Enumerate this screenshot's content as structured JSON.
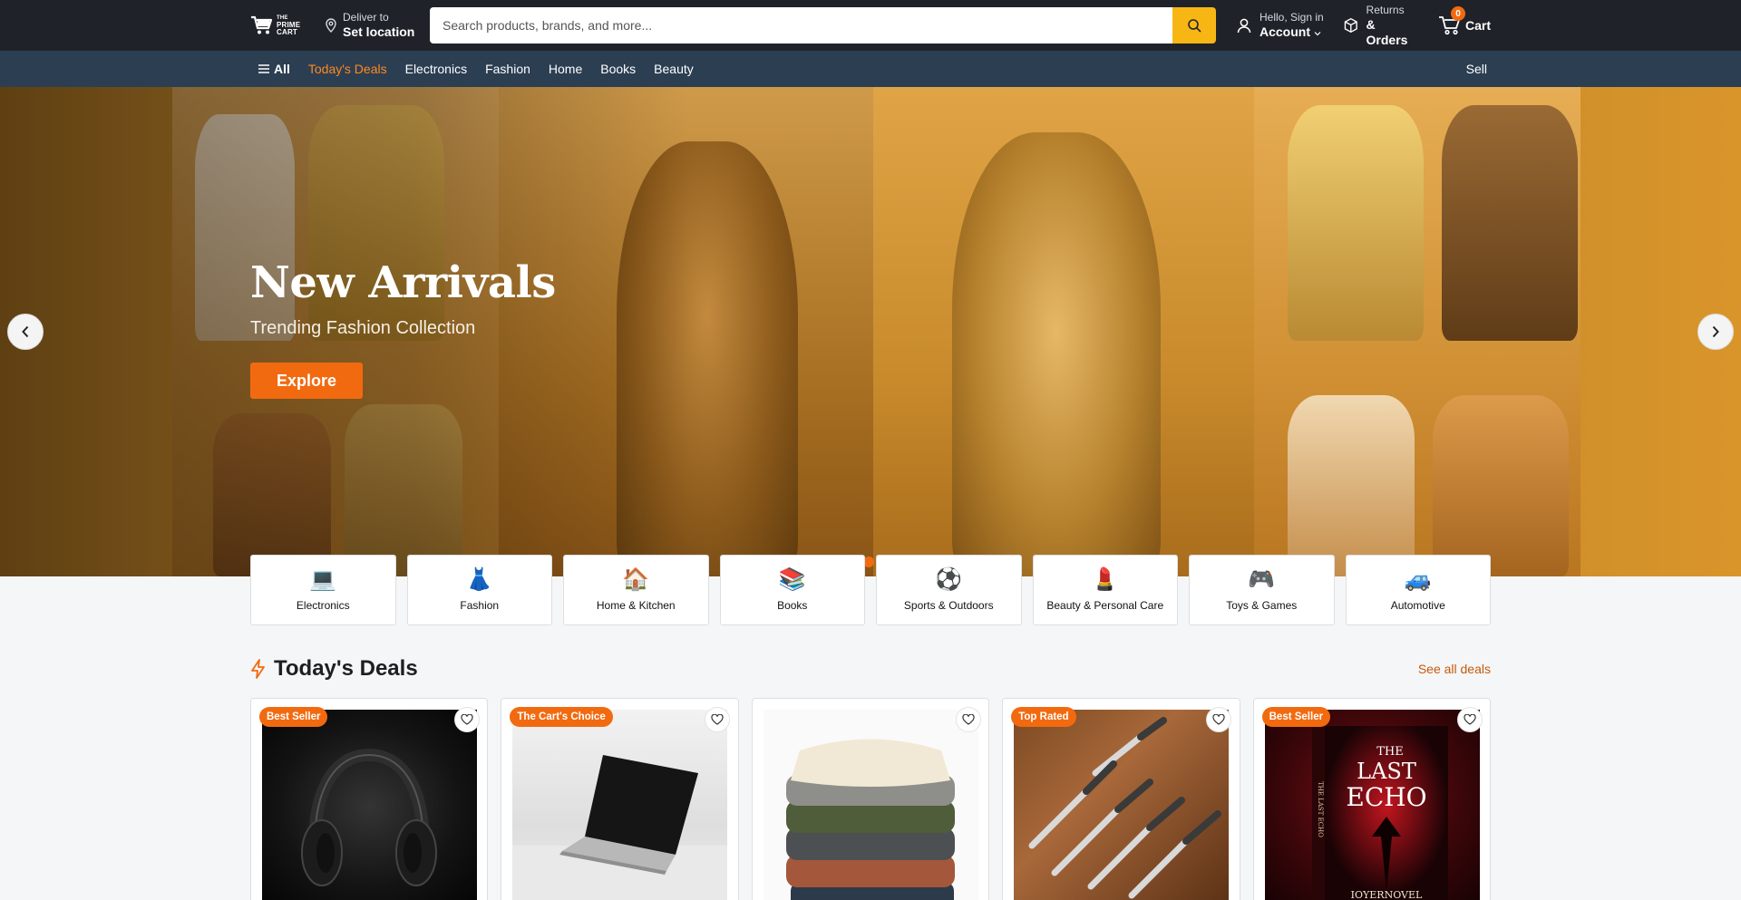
{
  "header": {
    "logo_text_line1": "THE",
    "logo_text_line2": "PRIME",
    "logo_text_line3": "CART",
    "deliver_small": "Deliver to",
    "deliver_big": "Set location",
    "search_placeholder": "Search products, brands, and more...",
    "account_small": "Hello, Sign in",
    "account_big": "Account",
    "orders_small": "Returns",
    "orders_big": "& Orders",
    "cart_label": "Cart",
    "cart_count": "0"
  },
  "nav": {
    "all_label": "All",
    "items": [
      "Today's Deals",
      "Electronics",
      "Fashion",
      "Home",
      "Books",
      "Beauty"
    ],
    "sell_label": "Sell"
  },
  "hero": {
    "title": "New Arrivals",
    "subtitle": "Trending Fashion Collection",
    "button_label": "Explore"
  },
  "categories": [
    {
      "icon": "💻",
      "label": "Electronics"
    },
    {
      "icon": "👗",
      "label": "Fashion"
    },
    {
      "icon": "🏠",
      "label": "Home & Kitchen"
    },
    {
      "icon": "📚",
      "label": "Books"
    },
    {
      "icon": "⚽",
      "label": "Sports & Outdoors"
    },
    {
      "icon": "💄",
      "label": "Beauty & Personal Care"
    },
    {
      "icon": "🎮",
      "label": "Toys & Games"
    },
    {
      "icon": "🚙",
      "label": "Automotive"
    }
  ],
  "deals": {
    "title": "Today's Deals",
    "see_all": "See all deals",
    "items": [
      {
        "badge": "Best Seller",
        "image": "headphones"
      },
      {
        "badge": "The Cart's Choice",
        "image": "laptop"
      },
      {
        "badge": "",
        "image": "sweaters"
      },
      {
        "badge": "Top Rated",
        "image": "knives"
      },
      {
        "badge": "Best Seller",
        "image": "book",
        "book_title_line1": "THE",
        "book_title_line2": "LAST",
        "book_title_line3": "ECHO",
        "book_author": "IOYERNOVEL",
        "book_spine": "THE LAST ECHO"
      }
    ]
  },
  "colors": {
    "header_bg": "#1f2329",
    "nav_bg": "#2c3e52",
    "accent": "#f26a10",
    "search_button": "#f7b613",
    "deals_link": "#c55a0c"
  }
}
